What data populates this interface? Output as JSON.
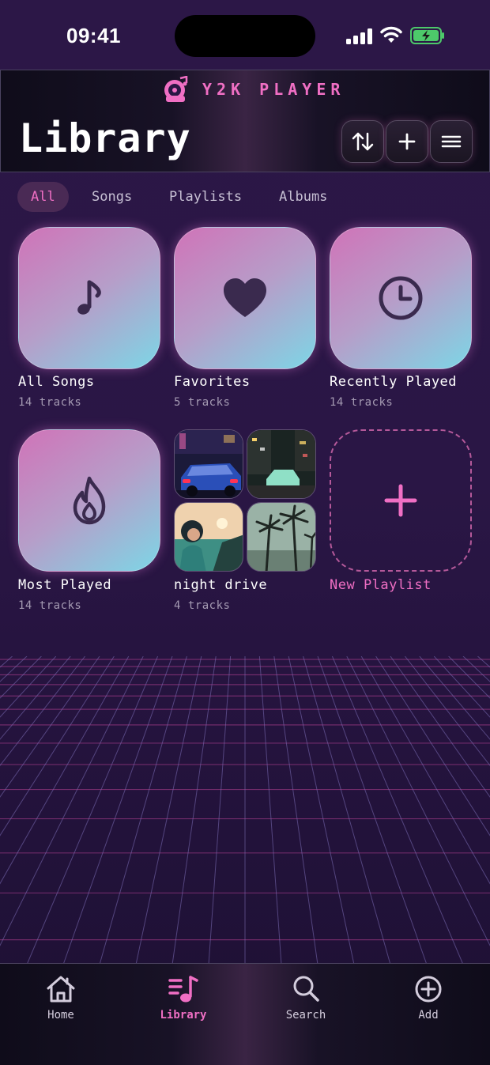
{
  "status": {
    "time": "09:41"
  },
  "header": {
    "brand": "Y2K PLAYER",
    "title": "Library"
  },
  "filters": [
    {
      "label": "All",
      "active": true
    },
    {
      "label": "Songs",
      "active": false
    },
    {
      "label": "Playlists",
      "active": false
    },
    {
      "label": "Albums",
      "active": false
    }
  ],
  "library": [
    {
      "name": "All Songs",
      "count": "14 tracks",
      "icon": "music-note-icon"
    },
    {
      "name": "Favorites",
      "count": "5 tracks",
      "icon": "heart-icon"
    },
    {
      "name": "Recently Played",
      "count": "14 tracks",
      "icon": "clock-icon"
    },
    {
      "name": "Most Played",
      "count": "14 tracks",
      "icon": "flame-icon"
    },
    {
      "name": "night drive",
      "count": "4 tracks",
      "icon": "playlist-collage"
    }
  ],
  "new_playlist": {
    "label": "New Playlist"
  },
  "tabbar": [
    {
      "label": "Home",
      "icon": "home-icon"
    },
    {
      "label": "Library",
      "icon": "library-icon",
      "active": true
    },
    {
      "label": "Search",
      "icon": "search-icon"
    },
    {
      "label": "Add",
      "icon": "add-circle-icon"
    }
  ],
  "colors": {
    "accent": "#f06fc4",
    "background": "#2a1645",
    "tile_top": "#d073b8",
    "tile_bottom": "#7dd6e6"
  }
}
